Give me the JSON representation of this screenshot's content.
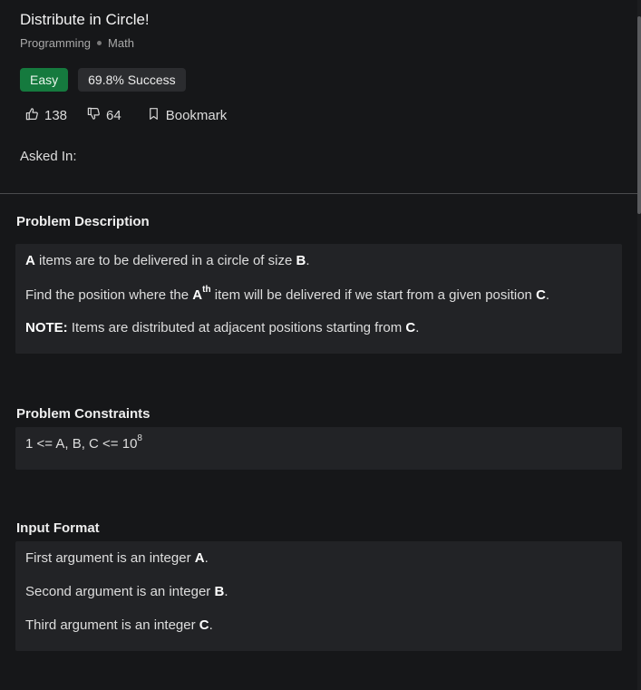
{
  "problem": {
    "title": "Distribute in Circle!",
    "tags": [
      "Programming",
      "Math"
    ]
  },
  "badges": {
    "difficulty": "Easy",
    "success": "69.8% Success"
  },
  "actions": {
    "upvotes": "138",
    "downvotes": "64",
    "bookmark_label": "Bookmark"
  },
  "asked_in_label": "Asked In:",
  "description": {
    "heading": "Problem Description",
    "line1": {
      "var_a": "A",
      "text": " items are to be delivered in a circle of size ",
      "var_b": "B",
      "end": "."
    },
    "line2": {
      "text": "Find the position where the ",
      "var_a": "A",
      "sup": "th",
      "text2": " item will be delivered if we start from a given position ",
      "var_c": "C",
      "end": "."
    },
    "line3": {
      "note": "NOTE:",
      "text": " Items are distributed at adjacent positions starting from ",
      "var_c": "C",
      "end": "."
    }
  },
  "constraints": {
    "heading": "Problem Constraints",
    "text": "1 <= A, B, C <= 10",
    "sup": "8"
  },
  "input_format": {
    "heading": "Input Format",
    "lines": [
      {
        "text": "First argument is an integer ",
        "var": "A",
        "end": "."
      },
      {
        "text": "Second argument is an integer ",
        "var": "B",
        "end": "."
      },
      {
        "text": "Third argument is an integer ",
        "var": "C",
        "end": "."
      }
    ]
  }
}
